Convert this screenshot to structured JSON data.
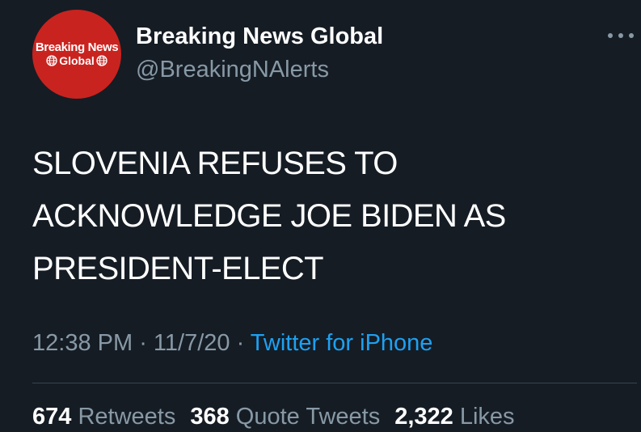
{
  "colors": {
    "background": "#151c24",
    "text_primary": "#ffffff",
    "text_secondary": "#8899a6",
    "link": "#1da1f2",
    "avatar_bg": "#c9231f",
    "divider": "#38444d"
  },
  "author": {
    "avatar": {
      "line1": "Breaking News",
      "line2": "Global",
      "icon": "globe-icon"
    },
    "display_name": "Breaking News Global",
    "handle": "@BreakingNAlerts"
  },
  "more_menu": {
    "icon": "more-horizontal-icon"
  },
  "tweet": {
    "lines": [
      "SLOVENIA REFUSES TO",
      "ACKNOWLEDGE JOE BIDEN AS",
      "PRESIDENT-ELECT"
    ],
    "time": "12:38 PM",
    "sep1": " · ",
    "date": "11/7/20",
    "sep2": " · ",
    "source": "Twitter for iPhone"
  },
  "stats": {
    "retweets": {
      "count": "674",
      "label": "Retweets"
    },
    "quote_tweets": {
      "count": "368",
      "label": "Quote Tweets"
    },
    "likes": {
      "count": "2,322",
      "label": "Likes"
    }
  }
}
